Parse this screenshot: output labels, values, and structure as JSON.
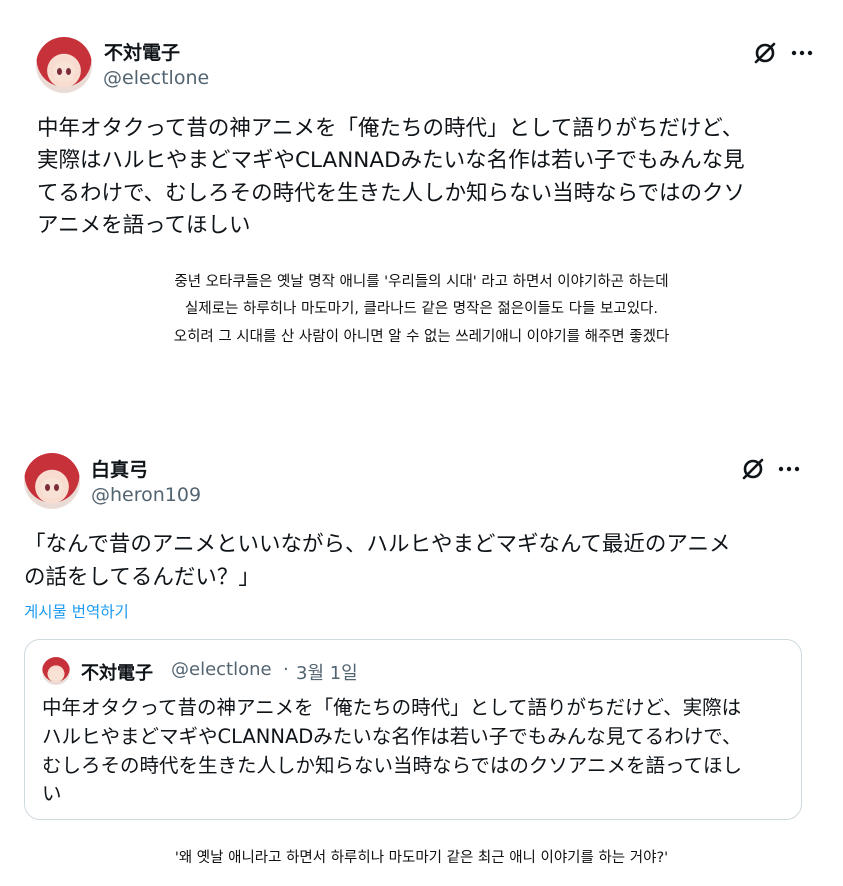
{
  "post1": {
    "author_name": "不対電子",
    "author_handle": "@electlone",
    "icons": {
      "grok": "slashed-circle-icon",
      "more": "more-dots-icon"
    },
    "text_lines": [
      "中年オタクって昔の神アニメを「俺たちの時代」として語りがちだけど、",
      "実際はハルヒやまどマギやCLANNADみたいな名作は若い子でもみんな見",
      "てるわけで、むしろその時代を生きた人しか知らない当時ならではのクソ",
      "アニメを語ってほしい"
    ]
  },
  "caption1": {
    "lines": [
      "중년 오타쿠들은 옛날 명작 애니를 '우리들의 시대' 라고 하면서 이야기하곤 하는데",
      "실제로는 하루히나 마도마기, 클라나드 같은 명작은 젊은이들도 다들 보고있다.",
      "오히려 그 시대를 산 사람이 아니면 알 수 없는 쓰레기애니 이야기를 해주면 좋겠다"
    ]
  },
  "post2": {
    "author_name": "白真弓",
    "author_handle": "@heron109",
    "icons": {
      "grok": "slashed-circle-icon",
      "more": "more-dots-icon"
    },
    "text_lines": [
      "「なんで昔のアニメといいながら、ハルヒやまどマギなんて最近のアニメ",
      "の話をしてるんだい？」"
    ],
    "translate_label": "게시물 번역하기",
    "quote": {
      "author_name": "不対電子",
      "author_handle": "@electlone",
      "separator": "·",
      "date": "3월 1일",
      "text_lines": [
        "中年オタクって昔の神アニメを「俺たちの時代」として語りがちだけど、実際は",
        "ハルヒやまどマギやCLANNADみたいな名作は若い子でもみんな見てるわけで、",
        "むしろその時代を生きた人しか知らない当時ならではのクソアニメを語ってほし",
        "い"
      ]
    }
  },
  "caption2": {
    "text": "'왜 옛날 애니라고 하면서 하루히나 마도마기 같은 최근 애니 이야기를 하는 거야?'"
  }
}
